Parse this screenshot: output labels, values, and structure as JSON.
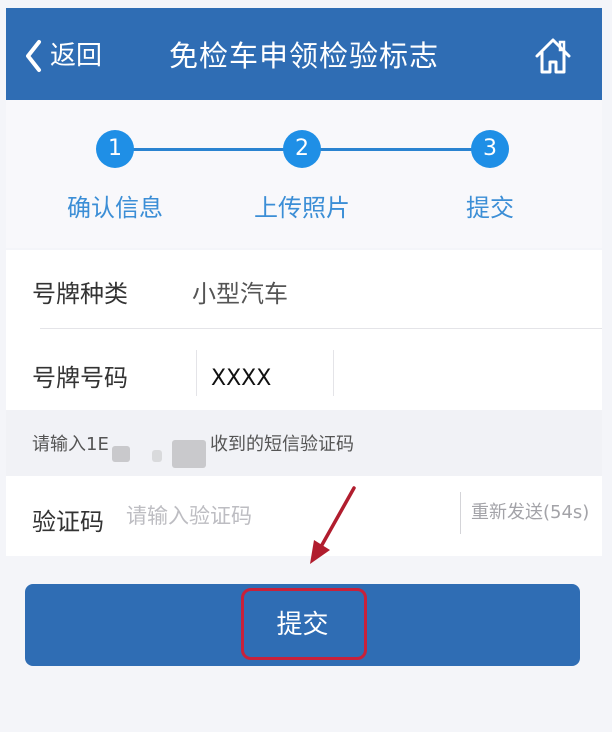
{
  "header": {
    "back_label": "返回",
    "title": "免检车申领检验标志",
    "home_icon": "home-icon"
  },
  "steps": [
    {
      "number": "1",
      "label": "确认信息"
    },
    {
      "number": "2",
      "label": "上传照片"
    },
    {
      "number": "3",
      "label": "提交"
    }
  ],
  "form": {
    "plate_type": {
      "label": "号牌种类",
      "value": "小型汽车"
    },
    "plate_number": {
      "label": "号牌号码",
      "value": "XXXX"
    },
    "hint_prefix": "请输入1E",
    "hint_suffix": "收到的短信验证码",
    "code": {
      "label": "验证码",
      "placeholder": "请输入验证码",
      "resend_label": "重新发送(54s)"
    }
  },
  "submit_label": "提交",
  "colors": {
    "header": "#2f6db4",
    "step": "#1f8fe6",
    "highlight": "#c8213a"
  }
}
